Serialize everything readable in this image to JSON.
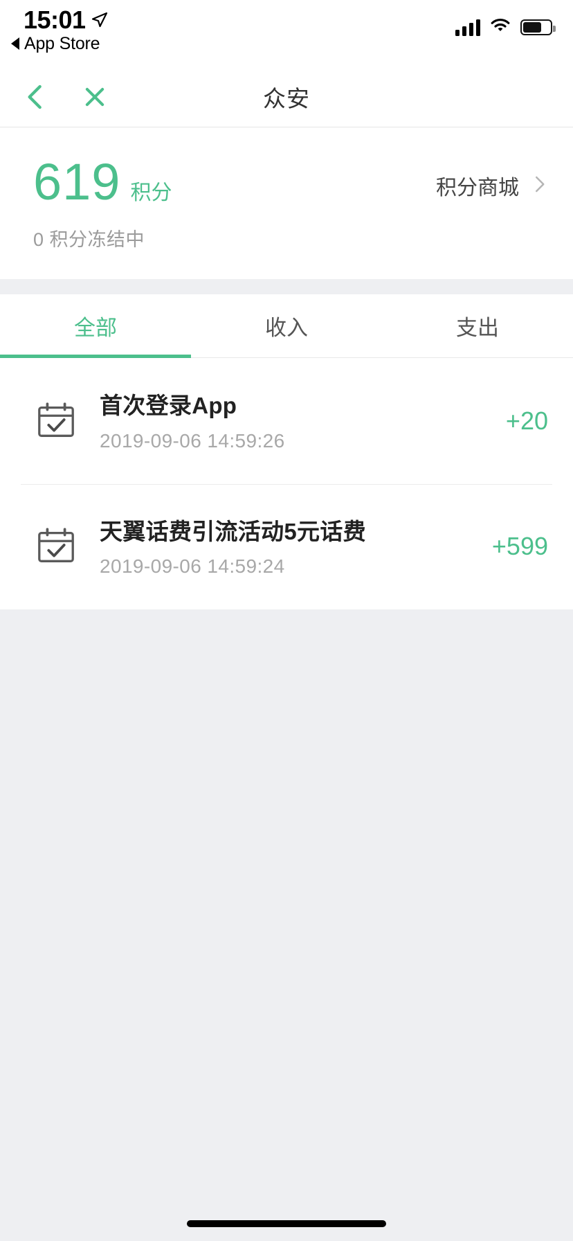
{
  "status_bar": {
    "time": "15:01",
    "location_icon": "location-arrow-icon",
    "back_app_label": "App Store",
    "signal_icon": "cellular-signal-icon",
    "wifi_icon": "wifi-icon",
    "battery_icon": "battery-icon",
    "battery_level_percent": 62
  },
  "nav": {
    "back_icon": "chevron-left-icon",
    "close_icon": "close-x-icon",
    "title": "众安"
  },
  "summary": {
    "points_value": "619",
    "points_unit": "积分",
    "frozen_text": "0 积分冻结中",
    "mall_label": "积分商城",
    "mall_chevron_icon": "chevron-right-icon"
  },
  "tabs": [
    {
      "label": "全部",
      "active": true
    },
    {
      "label": "收入",
      "active": false
    },
    {
      "label": "支出",
      "active": false
    }
  ],
  "transactions": [
    {
      "icon": "calendar-check-icon",
      "title": "首次登录App",
      "timestamp": "2019-09-06 14:59:26",
      "amount": "+20"
    },
    {
      "icon": "calendar-check-icon",
      "title": "天翼话费引流活动5元话费",
      "timestamp": "2019-09-06 14:59:24",
      "amount": "+599"
    }
  ],
  "colors": {
    "accent_green": "#4cbf8c",
    "page_background": "#eeeff2",
    "card_background": "#ffffff",
    "primary_text": "#222222",
    "muted_text": "#a8a8a8"
  },
  "home_indicator": "home-indicator"
}
